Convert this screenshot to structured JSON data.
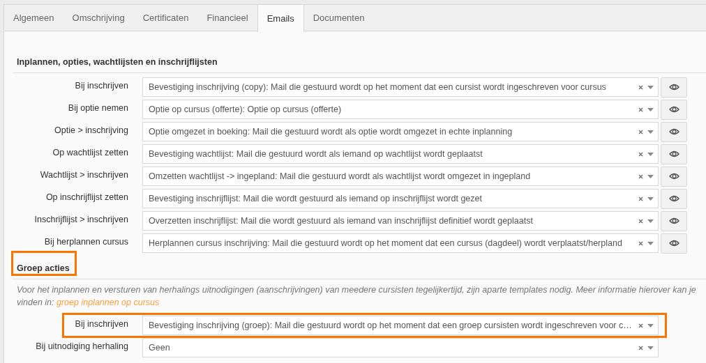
{
  "tabs": [
    {
      "label": "Algemeen",
      "selected": false
    },
    {
      "label": "Omschrijving",
      "selected": false
    },
    {
      "label": "Certificaten",
      "selected": false
    },
    {
      "label": "Financieel",
      "selected": false
    },
    {
      "label": "Emails",
      "selected": true
    },
    {
      "label": "Documenten",
      "selected": false
    }
  ],
  "sections": [
    {
      "heading": "Inplannen, opties, wachtlijsten en inschrijflijsten",
      "highlighted": false,
      "rows": [
        {
          "kind": "select-preview",
          "label": "Bij inschrijven",
          "value": "Bevestiging inschrijving (copy): Mail die gestuurd wordt op het moment dat een cursist wordt ingeschreven voor cursus",
          "highlighted": false
        },
        {
          "kind": "select-preview",
          "label": "Bij optie nemen",
          "value": "Optie op cursus (offerte): Optie op cursus (offerte)",
          "highlighted": false
        },
        {
          "kind": "select-preview",
          "label": "Optie > inschrijving",
          "value": "Optie omgezet in boeking: Mail die gestuurd wordt als optie wordt omgezet in echte inplanning",
          "highlighted": false
        },
        {
          "kind": "select-preview",
          "label": "Op wachtlijst zetten",
          "value": "Bevestiging wachtlijst: Mail die gestuurd wordt als iemand op wachtlijst wordt geplaatst",
          "highlighted": false
        },
        {
          "kind": "select-preview",
          "label": "Wachtlijst > inschrijven",
          "value": "Omzetten wachtlijst -> ingepland: Mail die gestuurd wordt als wachtlijst wordt omgezet in ingepland",
          "highlighted": false
        },
        {
          "kind": "select-preview",
          "label": "Op inschrijflijst zetten",
          "value": "Bevestiging inschrijflijst: Mail die wordt gestuurd als iemand op inschrijflijst wordt gezet",
          "highlighted": false
        },
        {
          "kind": "select-preview",
          "label": "Inschrijflijst > inschrijven",
          "value": "Overzetten inschrijflijst: Mail die wordt gestuurd als iemand van inschrijflijst definitief wordt geplaatst",
          "highlighted": false
        },
        {
          "kind": "select-preview",
          "label": "Bij herplannen cursus",
          "value": "Herplannen cursus inschrijving: Mail die gestuurd wordt op het moment dat een cursus (dagdeel) wordt verplaatst/herpland",
          "highlighted": false
        }
      ]
    },
    {
      "heading": "Groep acties",
      "highlighted": true,
      "note": "Voor het inplannen en versturen van herhalings uitnodigingen (aanschrijvingen) van meedere cursisten tegelijkertijd, zijn aparte templates nodig. Meer informatie hierover kan je vinden in: ",
      "link": "groep inplannen op cursus",
      "rows": [
        {
          "kind": "select",
          "label": "Bij inschrijven",
          "value": "Bevestiging inschrijving (groep): Mail die gestuurd wordt op het moment dat een groep cursisten wordt ingeschreven voor c…",
          "highlighted": true
        },
        {
          "kind": "select",
          "label": "Bij uitnodiging herhaling",
          "value": "Geen",
          "highlighted": false
        }
      ]
    }
  ]
}
